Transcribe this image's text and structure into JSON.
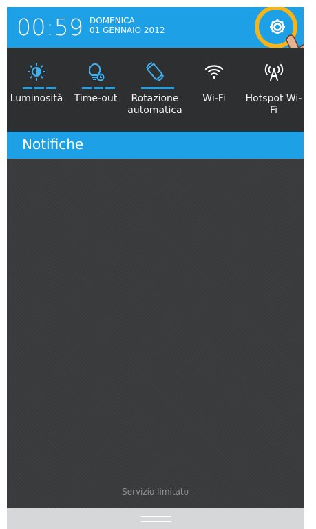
{
  "status": {
    "time": "00:59",
    "day_of_week": "DOMENICA",
    "date": "01 GENNAIO 2012"
  },
  "quick_settings": [
    {
      "label": "Luminosità",
      "icon": "brightness-icon",
      "active": true
    },
    {
      "label": "Time-out",
      "icon": "timeout-bulb-icon",
      "active": true
    },
    {
      "label": "Rotazione automatica",
      "icon": "auto-rotate-icon",
      "active": true
    },
    {
      "label": "Wi-Fi",
      "icon": "wifi-icon",
      "active": false
    },
    {
      "label": "Hotspot Wi-Fi",
      "icon": "hotspot-icon",
      "active": false
    }
  ],
  "notifications": {
    "title": "Notifiche",
    "service_status": "Servizio limitato"
  },
  "colors": {
    "accent": "#1ea0e6",
    "highlight_ring": "#f7b416",
    "panel": "#2d2f31"
  },
  "icons": {
    "settings": "gear-icon",
    "pointer": "hand-pointer-icon"
  }
}
